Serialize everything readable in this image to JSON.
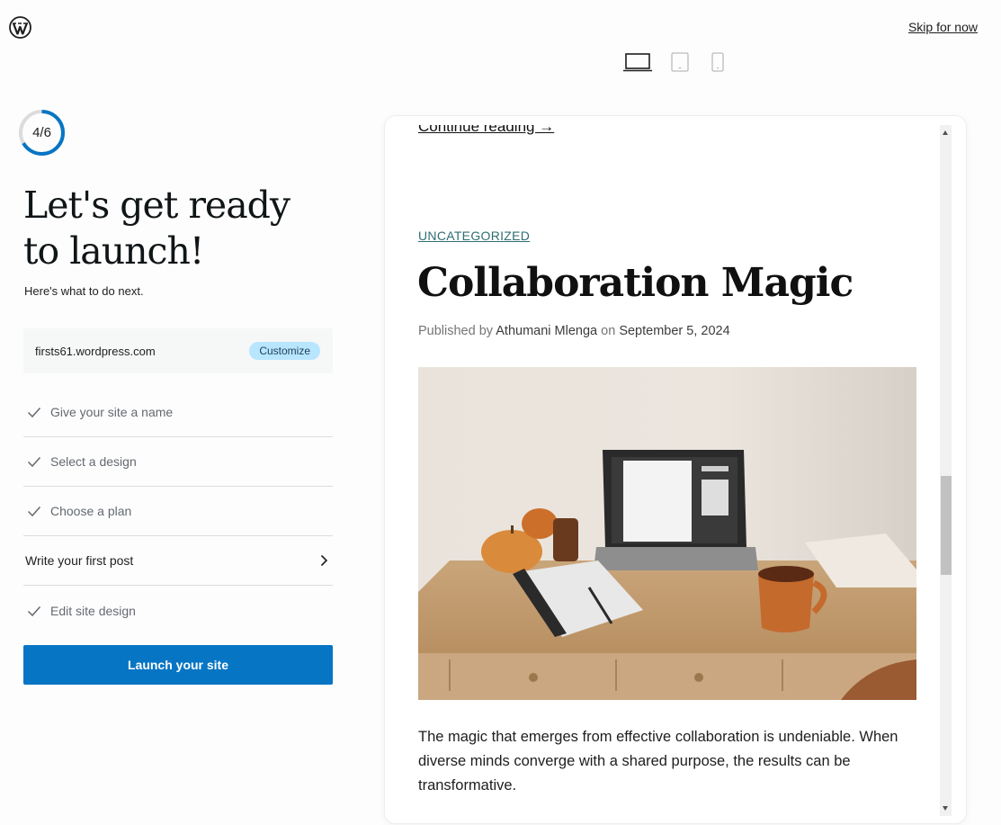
{
  "header": {
    "logo_icon": "wordpress-logo",
    "skip_label": "Skip for now",
    "devices": [
      "desktop-icon",
      "tablet-icon",
      "phone-icon"
    ],
    "selected_device": "desktop"
  },
  "progress": {
    "label": "4/6",
    "fraction": 0.6667,
    "accent": "#0675c4"
  },
  "intro": {
    "title_line1": "Let's get ready",
    "title_line2": "to launch!",
    "subtitle": "Here's what to do next."
  },
  "site": {
    "url_prefix": "firsts61.",
    "url_domain": "wordpress.com",
    "customize_label": "Customize"
  },
  "checklist": [
    {
      "label": "Give your site a name",
      "done": true
    },
    {
      "label": "Select a design",
      "done": true
    },
    {
      "label": "Choose a plan",
      "done": true
    },
    {
      "label": "Write your first post",
      "done": false
    },
    {
      "label": "Edit site design",
      "done": true
    }
  ],
  "launch_label": "Launch your site",
  "preview": {
    "continue_label": "Continue reading →",
    "category": "UNCATEGORIZED",
    "post_title": "Collaboration Magic",
    "byline_prefix": "Published by",
    "author": "Athumani Mlenga",
    "byline_on": "on",
    "date": "September 5, 2024",
    "excerpt": "The magic that emerges from effective collaboration is undeniable. When diverse minds converge with a shared purpose, the results can be transformative."
  },
  "colors": {
    "primary_button": "#0675c4",
    "badge_bg": "#b8e6ff",
    "category_link": "#2f6e72"
  }
}
